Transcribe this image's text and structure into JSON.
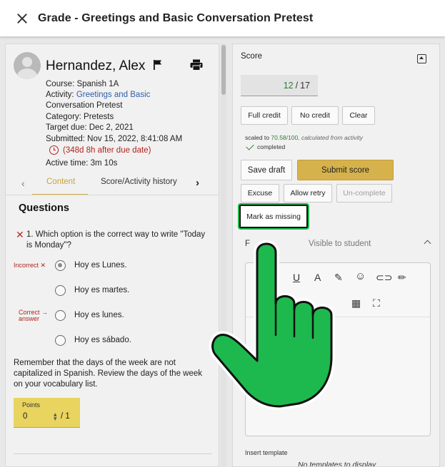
{
  "header": {
    "title": "Grade - Greetings and Basic Conversation Pretest"
  },
  "student": {
    "name": "Hernandez, Alex",
    "course": "Course: Spanish 1A",
    "activity_prefix": "Activity: ",
    "activity_link_line1": "Greetings and Basic",
    "activity_link_line2": "Conversation Pretest",
    "category": "Category: Pretests",
    "target_due": "Target due: Dec 2, 2021",
    "submitted": "Submitted: Nov 15, 2022, 8:41:08 AM",
    "late": "(348d 8h after due date)",
    "active_time": "Active time:  3m 10s"
  },
  "tabs": {
    "content": "Content",
    "history": "Score/Activity history",
    "prev": "‹",
    "next": "›"
  },
  "questions": {
    "heading": "Questions",
    "q1_text": "1. Which option is the correct way to write \"Today is Monday\"?",
    "options": [
      {
        "label": "Hoy es Lunes.",
        "checked": true
      },
      {
        "label": "Hoy es martes.",
        "checked": false
      },
      {
        "label": "Hoy es lunes.",
        "checked": false
      },
      {
        "label": "Hoy es sábado.",
        "checked": false
      }
    ],
    "incorrect_tag": "Incorrect",
    "correct_tag_line1": "Correct",
    "correct_tag_line2": "answer",
    "feedback": "Remember that the days of the week are not capitalized in Spanish. Review the days of the week on your vocabulary list.",
    "points_label": "Points",
    "points_value": "0",
    "points_max": "/ 1"
  },
  "score": {
    "heading": "Score",
    "earned": "12",
    "separator": "/",
    "total": "17",
    "full_credit": "Full credit",
    "no_credit": "No credit",
    "clear": "Clear",
    "scaled_prefix": "scaled to ",
    "scaled_value": "70.58/100",
    "scaled_note": ", calculated from activity",
    "completed": "completed",
    "save_draft": "Save draft",
    "submit_score": "Submit score",
    "excuse": "Excuse",
    "allow_retry": "Allow retry",
    "uncomplete": "Un-complete",
    "mark_missing": "Mark as missing"
  },
  "feedback_section": {
    "label": "F",
    "visible": "Visible to student",
    "insert_template": "Insert template",
    "no_templates": "No templates to display"
  },
  "colors": {
    "accent": "#d6b24c",
    "points_bg": "#e8d45f",
    "error": "#b2231e",
    "success": "#2e7d32",
    "link": "#2f5fa8",
    "hand": "#1db94e"
  }
}
